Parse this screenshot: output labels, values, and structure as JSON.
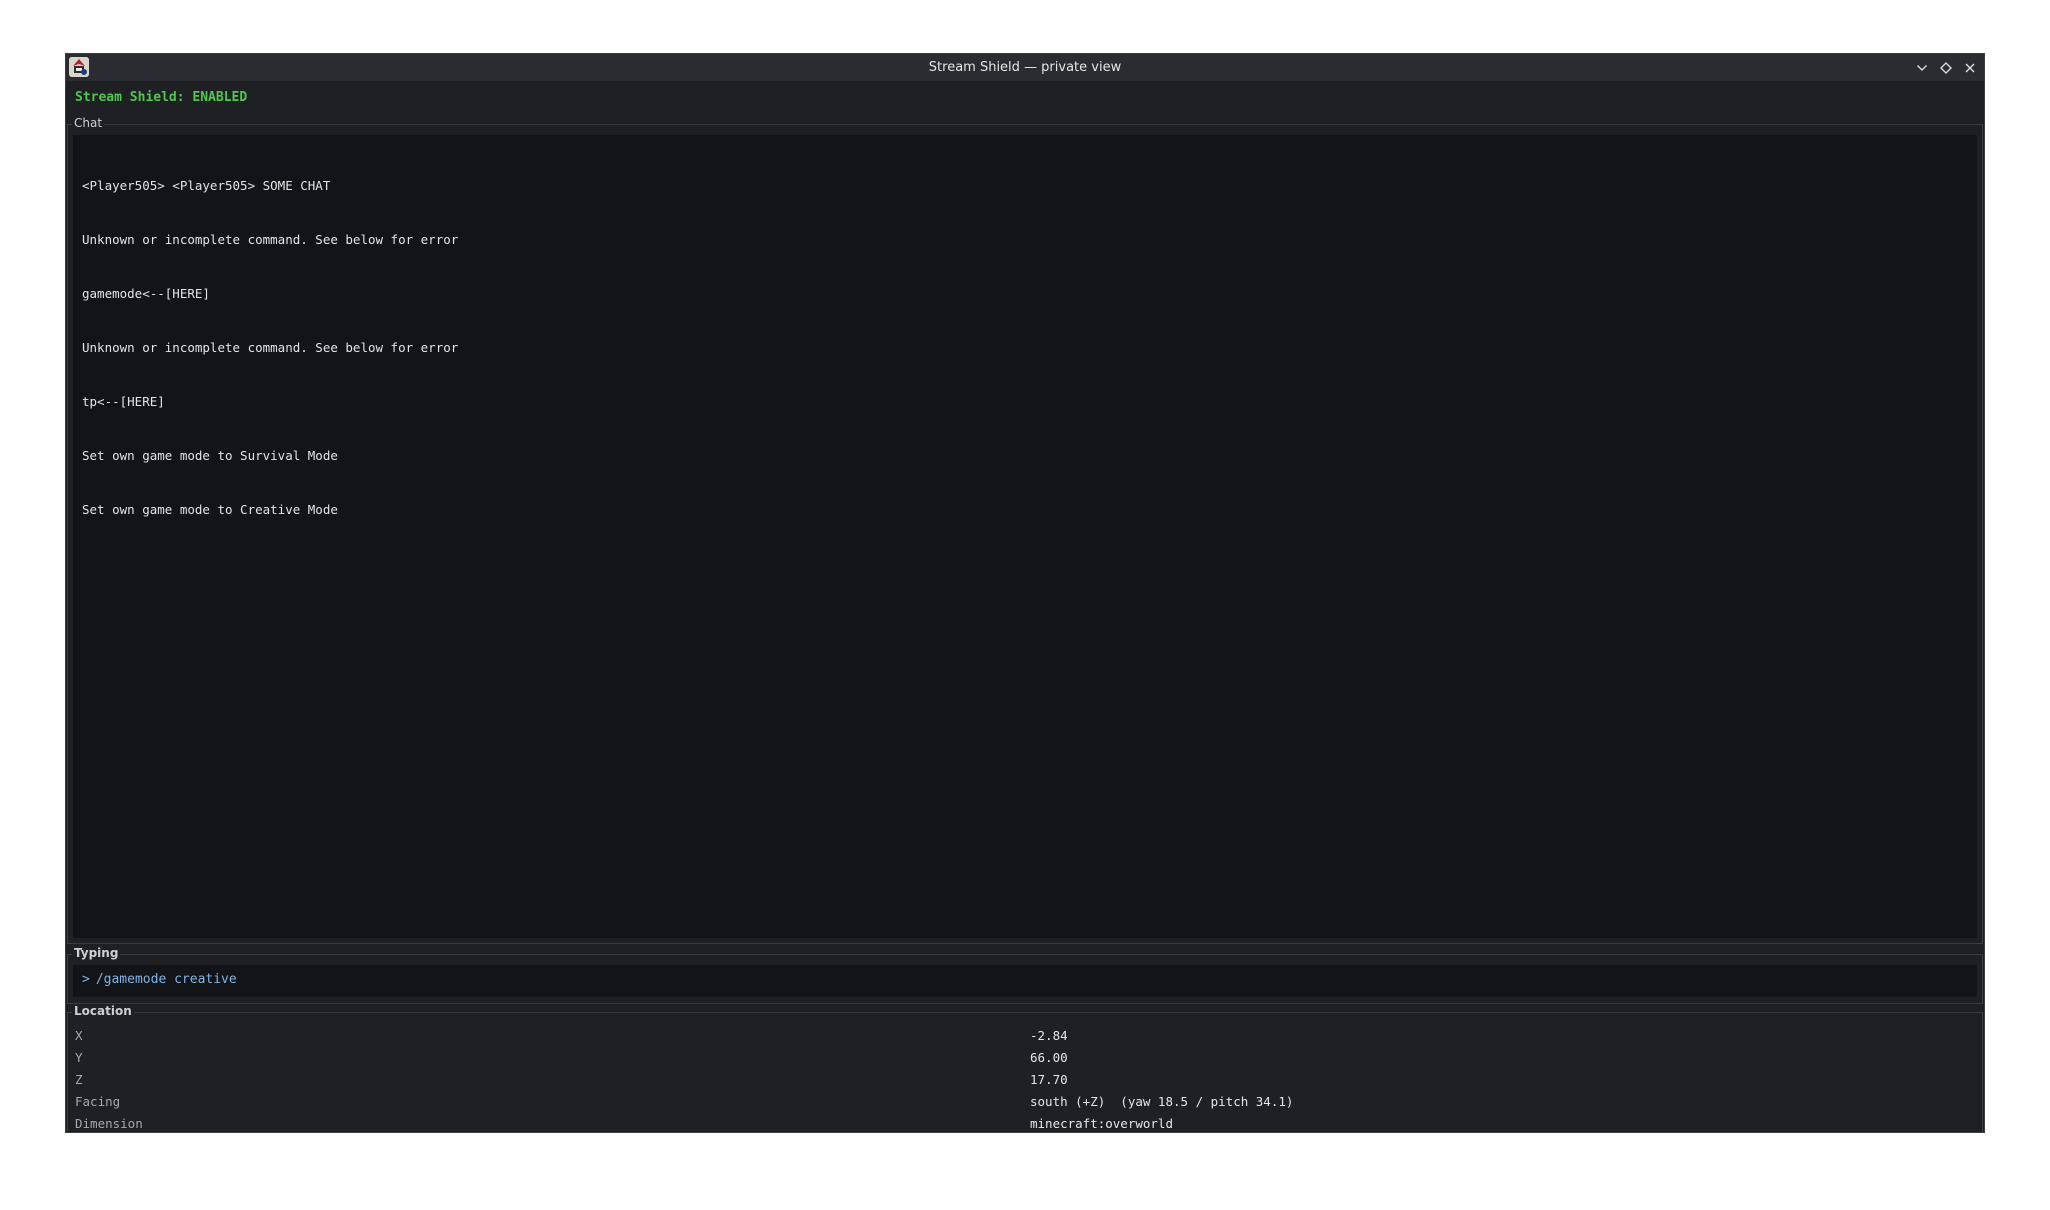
{
  "window": {
    "title": "Stream Shield — private view"
  },
  "icons": {
    "app": "app-icon",
    "minimize": "chevron-down-icon",
    "maximize": "diamond-icon",
    "close": "close-icon"
  },
  "status": {
    "text": "Stream Shield: ENABLED",
    "color": "#4ec94e"
  },
  "chat": {
    "label": "Chat",
    "lines": [
      "<Player505> <Player505> SOME CHAT",
      "Unknown or incomplete command. See below for error",
      "gamemode<--[HERE]",
      "Unknown or incomplete command. See below for error",
      "tp<--[HERE]",
      "Set own game mode to Survival Mode",
      "Set own game mode to Creative Mode"
    ]
  },
  "typing": {
    "label": "Typing",
    "prompt": ">",
    "text": "/gamemode creative"
  },
  "location": {
    "label": "Location",
    "rows": [
      {
        "key": "X",
        "value": "-2.84"
      },
      {
        "key": "Y",
        "value": "66.00"
      },
      {
        "key": "Z",
        "value": "17.70"
      },
      {
        "key": "Facing",
        "value": "south (+Z)  (yaw 18.5 / pitch 34.1)"
      },
      {
        "key": "Dimension",
        "value": "minecraft:overworld"
      }
    ]
  }
}
